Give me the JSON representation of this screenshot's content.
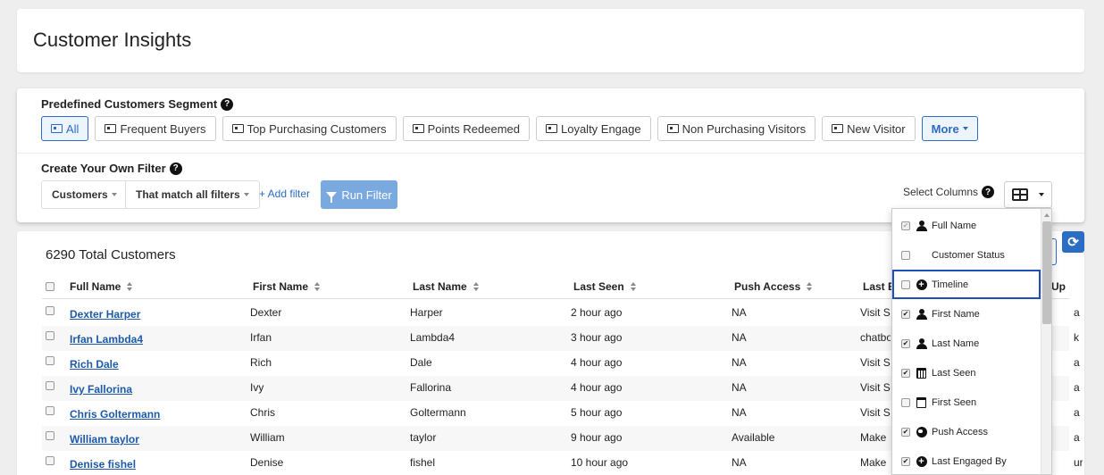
{
  "page": {
    "title": "Customer Insights"
  },
  "segments": {
    "label": "Predefined Customers Segment",
    "buttons": [
      {
        "label": "All",
        "active": true
      },
      {
        "label": "Frequent Buyers"
      },
      {
        "label": "Top Purchasing Customers"
      },
      {
        "label": "Points Redeemed"
      },
      {
        "label": "Loyalty Engage"
      },
      {
        "label": "Non Purchasing Visitors"
      },
      {
        "label": "New Visitor"
      }
    ],
    "more_label": "More"
  },
  "filter": {
    "label": "Create Your Own Filter",
    "entity_dropdown": "Customers",
    "match_dropdown": "That match all filters",
    "add_filter": "+ Add filter",
    "run_filter": "Run Filter",
    "select_columns": "Select Columns"
  },
  "table": {
    "total": "6290 Total Customers",
    "columns": [
      "Full Name",
      "First Name",
      "Last Name",
      "Last Seen",
      "Push Access",
      "Last E",
      "Up"
    ],
    "rows": [
      {
        "full": "Dexter Harper",
        "first": "Dexter",
        "last": "Harper",
        "seen": "2 hour ago",
        "push": "NA",
        "engaged": "Visit S",
        "extra": "a"
      },
      {
        "full": "Irfan Lambda4",
        "first": "Irfan",
        "last": "Lambda4",
        "seen": "3 hour ago",
        "push": "NA",
        "engaged": "chatbo",
        "extra": "k a"
      },
      {
        "full": "Rich Dale",
        "first": "Rich",
        "last": "Dale",
        "seen": "4 hour ago",
        "push": "NA",
        "engaged": "Visit S",
        "extra": "a"
      },
      {
        "full": "Ivy Fallorina",
        "first": "Ivy",
        "last": "Fallorina",
        "seen": "4 hour ago",
        "push": "NA",
        "engaged": "Visit S",
        "extra": "a"
      },
      {
        "full": "Chris Goltermann",
        "first": "Chris",
        "last": "Goltermann",
        "seen": "5 hour ago",
        "push": "NA",
        "engaged": "Visit S",
        "extra": "a"
      },
      {
        "full": "William taylor",
        "first": "William",
        "last": "taylor",
        "seen": "9 hour ago",
        "push": "Available",
        "engaged": "Make",
        "extra": "a"
      },
      {
        "full": "Denise fishel",
        "first": "Denise",
        "last": "fishel",
        "seen": "10 hour ago",
        "push": "NA",
        "engaged": "Make",
        "extra": "ur"
      }
    ]
  },
  "column_menu": {
    "items": [
      {
        "label": "Full Name",
        "checked": true,
        "icon": "person-icon"
      },
      {
        "label": "Customer Status",
        "checked": false,
        "icon": ""
      },
      {
        "label": "Timeline",
        "checked": false,
        "icon": "plus-circle-icon",
        "highlight": true
      },
      {
        "label": "First Name",
        "checked": true,
        "icon": "person-icon"
      },
      {
        "label": "Last Name",
        "checked": true,
        "icon": "person-icon"
      },
      {
        "label": "Last Seen",
        "checked": true,
        "icon": "calendar-icon"
      },
      {
        "label": "First Seen",
        "checked": false,
        "icon": "calendar-icon"
      },
      {
        "label": "Push Access",
        "checked": true,
        "icon": "globe-icon"
      },
      {
        "label": "Last Engaged By",
        "checked": true,
        "icon": "plus-circle-icon"
      }
    ]
  },
  "colors": {
    "accent": "#2b6cc4",
    "run_button": "#7aa9e0",
    "link": "#1e5aa8",
    "highlight": "#1f4fb8"
  }
}
